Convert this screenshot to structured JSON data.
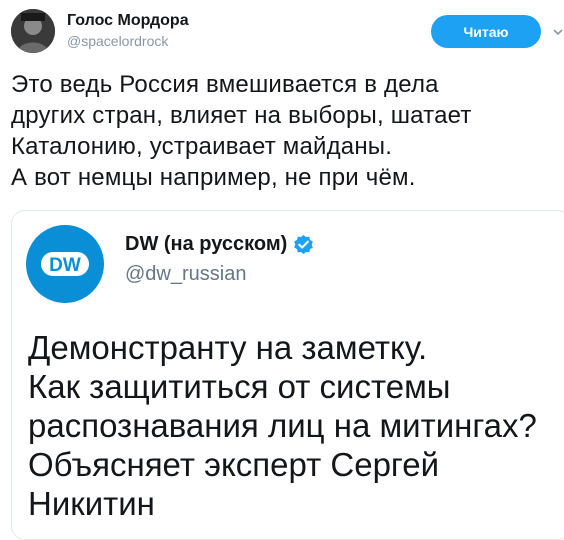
{
  "tweet": {
    "author_name": "Голос Мордора",
    "author_handle": "@spacelordrock",
    "follow_label": "Читаю",
    "text_lines": [
      "Это ведь Россия вмешивается в дела",
      "других стран, влияет на выборы, шатает",
      "Каталонию, устраивает майданы.",
      "А вот немцы например, не при чём."
    ]
  },
  "quoted": {
    "author_name": "DW (на русском)",
    "author_handle": "@dw_russian",
    "logo_text": "DW",
    "text_lines": [
      "Демонстранту на заметку.",
      "Как защититься от системы",
      "распознавания лиц на митингах?",
      "Объясняет эксперт Сергей",
      "Никитин"
    ]
  },
  "colors": {
    "accent": "#1da1f2",
    "dw_blue": "#0a8fd6",
    "muted": "#8899a6"
  }
}
